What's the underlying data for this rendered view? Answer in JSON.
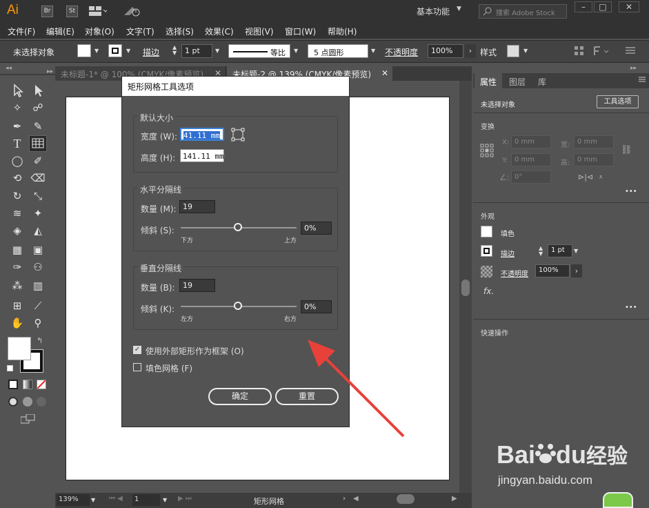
{
  "app": {
    "logo": "Ai",
    "br": "Br",
    "st": "St",
    "workspace": "基本功能",
    "search_placeholder": "搜索 Adobe Stock"
  },
  "menus": [
    "文件(F)",
    "编辑(E)",
    "对象(O)",
    "文字(T)",
    "选择(S)",
    "效果(C)",
    "视图(V)",
    "窗口(W)",
    "帮助(H)"
  ],
  "control": {
    "no_selection": "未选择对象",
    "stroke": "描边",
    "stroke_value": "1 pt",
    "line_style": "等比",
    "brush": "5 点圆形",
    "opacity_label": "不透明度",
    "opacity_value": "100%",
    "style_label": "样式"
  },
  "tabs": [
    "未标题-1* @ 100% (CMYK/像素预览)",
    "未标题-2 @ 139% (CMYK/像素预览)"
  ],
  "status": {
    "zoom": "139%",
    "page": "1",
    "tool": "矩形网格"
  },
  "panel": {
    "tabs": [
      "属性",
      "图层",
      "库"
    ],
    "no_selection": "未选择对象",
    "tool_options": "工具选项",
    "transform": "变换",
    "x_label": "X:",
    "y_label": "Y:",
    "w_label": "宽:",
    "h_label": "高:",
    "x": "0 mm",
    "y": "0 mm",
    "w": "0 mm",
    "h": "0 mm",
    "angle": "0°",
    "appearance": "外观",
    "fill": "填色",
    "stroke": "描边",
    "stroke_value": "1 pt",
    "opacity": "不透明度",
    "opacity_value": "100%",
    "fx": "fx.",
    "quick_actions": "快速操作",
    "more": "•••"
  },
  "dialog": {
    "title": "矩形网格工具选项",
    "default_size": "默认大小",
    "width_label": "宽度 (W):",
    "width_value": "41.11 mm",
    "height_label": "高度 (H):",
    "height_value": "141.11 mm",
    "horizontal": "水平分隔线",
    "h_count_label": "数量 (M):",
    "h_count": "19",
    "h_skew_label": "倾斜 (S):",
    "h_skew": "0%",
    "h_left": "下方",
    "h_right": "上方",
    "vertical": "垂直分隔线",
    "v_count_label": "数量 (B):",
    "v_count": "19",
    "v_skew_label": "倾斜 (K):",
    "v_skew": "0%",
    "v_left": "左方",
    "v_right": "右方",
    "use_outer": "使用外部矩形作为框架 (O)",
    "use_outer_checked": true,
    "fill_grid": "填色网格 (F)",
    "fill_grid_checked": false,
    "ok": "确定",
    "reset": "重置"
  },
  "watermark": {
    "brand": "Bai",
    "brand2": "du",
    "cn": "经验",
    "url": "jingyan.baidu.com"
  },
  "colors": {
    "arrow": "#e8413a",
    "logo": "#ff9a00"
  }
}
